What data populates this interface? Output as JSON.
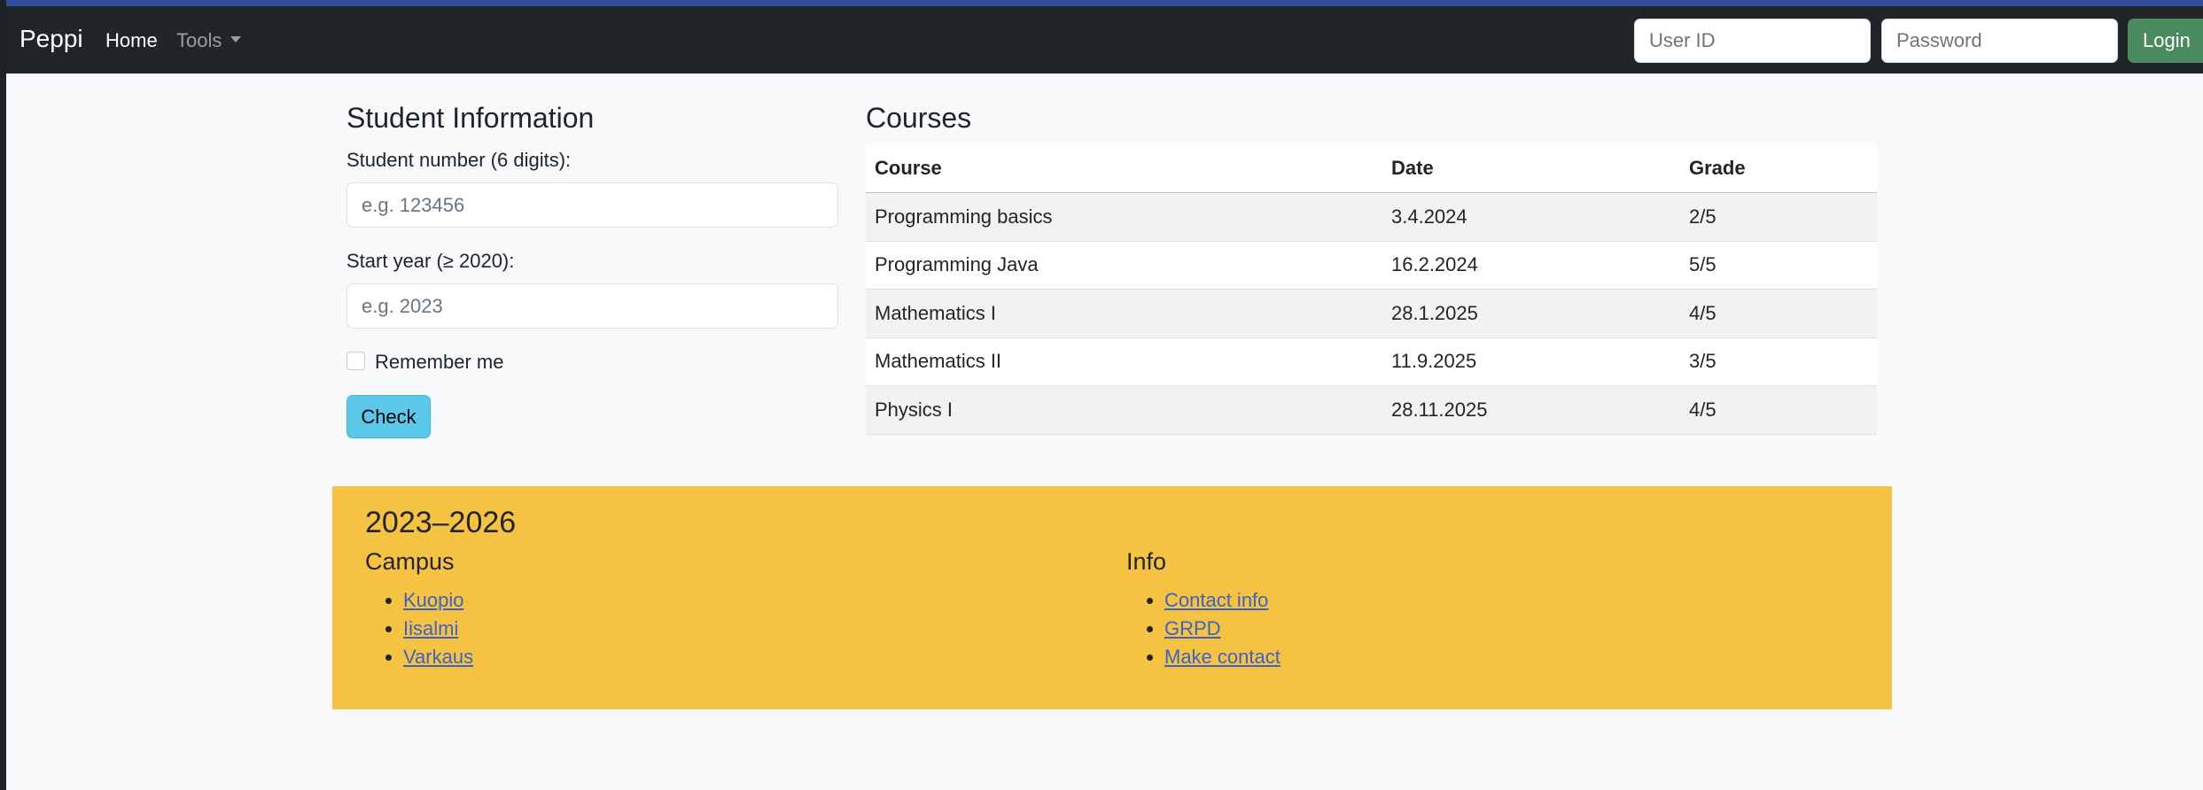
{
  "navbar": {
    "brand": "Peppi",
    "home": "Home",
    "tools": "Tools",
    "userid_placeholder": "User ID",
    "password_placeholder": "Password",
    "login": "Login"
  },
  "student": {
    "title": "Student Information",
    "number_label": "Student number (6 digits):",
    "number_placeholder": "e.g. 123456",
    "year_label": "Start year (≥ 2020):",
    "year_placeholder": "e.g. 2023",
    "remember": "Remember me",
    "check": "Check"
  },
  "courses": {
    "title": "Courses",
    "headers": [
      "Course",
      "Date",
      "Grade"
    ],
    "rows": [
      [
        "Programming basics",
        "3.4.2024",
        "2/5"
      ],
      [
        "Programming Java",
        "16.2.2024",
        "5/5"
      ],
      [
        "Mathematics I",
        "28.1.2025",
        "4/5"
      ],
      [
        "Mathematics II",
        "11.9.2025",
        "3/5"
      ],
      [
        "Physics I",
        "28.11.2025",
        "4/5"
      ]
    ]
  },
  "footer": {
    "years": "2023–2026",
    "campus_title": "Campus",
    "campus_links": [
      "Kuopio",
      "Iisalmi",
      "Varkaus"
    ],
    "info_title": "Info",
    "info_links": [
      "Contact info",
      "GRPD",
      "Make contact"
    ]
  }
}
